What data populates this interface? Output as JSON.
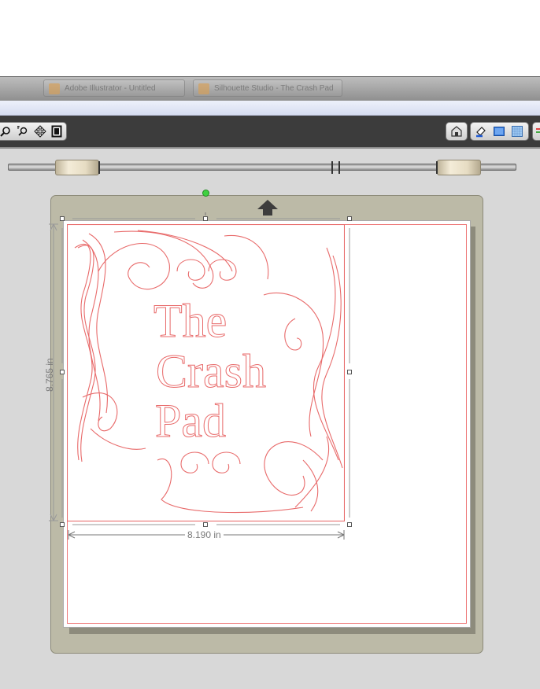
{
  "taskbar": {
    "items": [
      {
        "label": "Adobe Illustrator - Untitled"
      },
      {
        "label": "Silhouette Studio - The Crash Pad"
      }
    ]
  },
  "toolbar": {
    "left_icons": [
      "zoom-in-icon",
      "zoom-selection-icon",
      "pan-icon",
      "fit-page-icon"
    ],
    "right_icons": [
      "store-icon",
      "fill-icon",
      "page-setup-icon",
      "grid-icon"
    ]
  },
  "design": {
    "text_lines": [
      "The",
      "Crash",
      "Pad"
    ],
    "stroke_color": "#e86a6a"
  },
  "dimensions": {
    "width": "8.190 in",
    "height": "8.765 in"
  },
  "colors": {
    "toolbar_bg": "#3c3c3c",
    "mat": "#bcbaa7",
    "rotate_handle": "#3fd13f"
  }
}
